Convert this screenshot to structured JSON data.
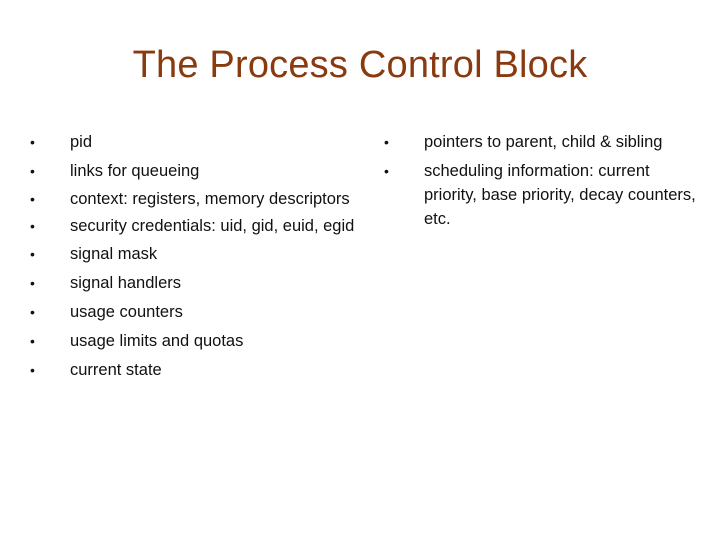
{
  "slide": {
    "title": "The Process Control Block",
    "title_color": "#8a3a0f",
    "left_bullets": [
      "pid",
      "links for queueing",
      "context: registers, memory descriptors",
      "security credentials: uid, gid, euid, egid",
      "signal mask",
      "signal handlers",
      "usage counters",
      "usage limits and quotas",
      "current state"
    ],
    "right_bullets": [
      "pointers to parent, child & sibling",
      "scheduling information: current priority, base priority, decay counters, etc."
    ],
    "bullet_glyph": "•"
  }
}
